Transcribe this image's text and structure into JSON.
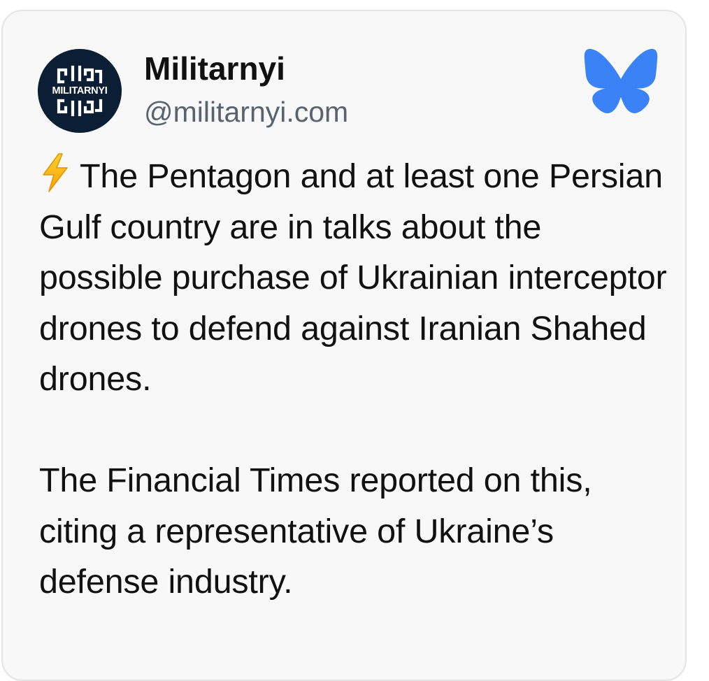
{
  "post": {
    "author": {
      "display_name": "Militarnyi",
      "handle": "@militarnyi.com",
      "avatar_text": "MILITARNYI"
    },
    "platform_icon": "bluesky-butterfly-icon",
    "brand_color": "#3b82f6",
    "emoji": "⚡",
    "paragraphs": [
      "The Pentagon and at least one Persian Gulf country are in talks about the possible purchase of Ukrainian interceptor drones to defend against Iranian Shahed drones.",
      "The Financial Times reported on this, citing a representative of Ukraine’s defense industry."
    ]
  }
}
